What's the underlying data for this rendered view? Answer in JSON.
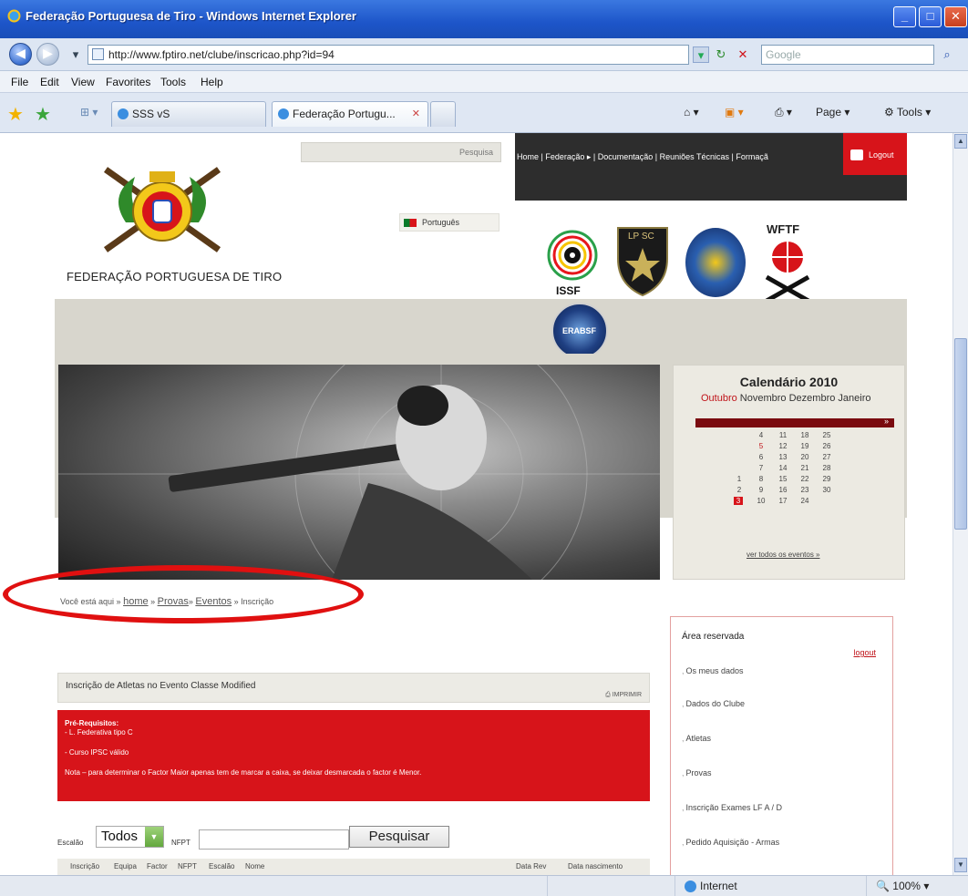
{
  "window": {
    "title": "Federação Portuguesa de Tiro - Windows Internet Explorer"
  },
  "addressbar": {
    "url": "http://www.fptiro.net/clube/inscricao.php?id=94",
    "search_placeholder": "Google"
  },
  "menubar": {
    "items": [
      "File",
      "Edit",
      "View",
      "Favorites",
      "Tools",
      "Help"
    ]
  },
  "tabs": [
    {
      "label": "SSS vS"
    },
    {
      "label": "Federação Portugu..."
    }
  ],
  "command_bar": {
    "page_label": "Page",
    "tools_label": "Tools"
  },
  "site": {
    "search_label": "Pesquisa",
    "nav": "Home  |  Federação ▸  |  Documentação  |  Reuniões Técnicas  |  Formaçã",
    "logout": "Logout",
    "language": "Português",
    "federation_name": "FEDERAÇÃO PORTUGUESA DE TIRO",
    "logos": {
      "issf": "ISSF",
      "lpsc": "LP SC",
      "wftf": "WFTF",
      "erabsf": "ERABSF"
    }
  },
  "calendar": {
    "title": "Calendário 2010",
    "months_prefix": "Outubro",
    "months_rest": " Novembro Dezembro Janeiro",
    "nav_arrow": "»",
    "days": [
      [
        "",
        "4",
        "11",
        "18",
        "25"
      ],
      [
        "",
        "5",
        "12",
        "19",
        "26"
      ],
      [
        "",
        "6",
        "13",
        "20",
        "27"
      ],
      [
        "",
        "7",
        "14",
        "21",
        "28"
      ],
      [
        "1",
        "8",
        "15",
        "22",
        "29"
      ],
      [
        "2",
        "9",
        "16",
        "23",
        "30"
      ],
      [
        "3",
        "10",
        "17",
        "24",
        ""
      ]
    ],
    "see_all": "ver todos os eventos »"
  },
  "breadcrumb": {
    "prefix": "Você está aqui »",
    "home": "home",
    "provas": "Provas",
    "eventos": "Eventos",
    "current": "» Inscrição"
  },
  "registration": {
    "title": "Inscrição de Atletas no Evento Classe Modified",
    "print": "IMPRIMIR",
    "prereq_heading": "Pré-Requisitos:",
    "prereq_1": "- L. Federativa tipo C",
    "prereq_2": "- Curso IPSC válido",
    "note": "Nota – para determinar o Factor Maior apenas tem de marcar a caixa, se deixar desmarcada o factor é Menor."
  },
  "filter": {
    "escalao_label": "Escalão",
    "escalao_value": "Todos",
    "nfpt_label": "NFPT",
    "search_button": "Pesquisar"
  },
  "table_headers": [
    "Inscrição",
    "Equipa",
    "Factor",
    "NFPT",
    "Escalão",
    "Nome",
    "Data Rev",
    "Data nascimento"
  ],
  "reserved_area": {
    "title": "Área reservada",
    "logout": "logout",
    "items": [
      "Os meus dados",
      "Dados do Clube",
      "Atletas",
      "Provas",
      "Inscrição Exames LF A / D",
      "Pedido Aquisição - Armas"
    ]
  },
  "statusbar": {
    "zone": "Internet",
    "zoom": "100%"
  }
}
